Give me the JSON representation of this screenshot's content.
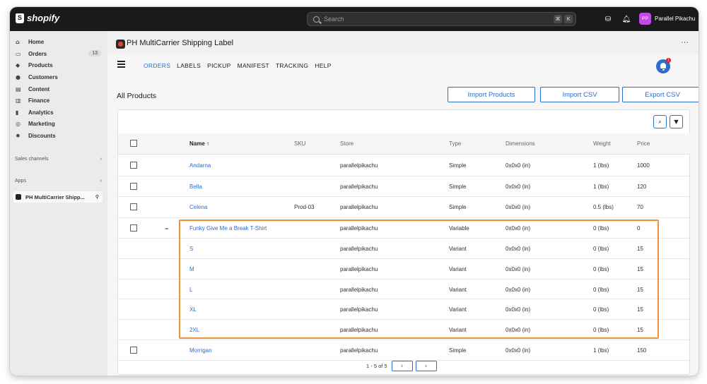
{
  "topbar": {
    "brand": "shopify",
    "search_placeholder": "Search",
    "shortcut_keys": [
      "⌘",
      "K"
    ],
    "user_initials": "PP",
    "user_name": "Parallel Pikachu"
  },
  "sidebar": {
    "items": [
      {
        "label": "Home",
        "icon": "home-icon",
        "glyph": "⌂"
      },
      {
        "label": "Orders",
        "icon": "orders-icon",
        "glyph": "▭",
        "badge": "13"
      },
      {
        "label": "Products",
        "icon": "tag-icon",
        "glyph": "◆"
      },
      {
        "label": "Customers",
        "icon": "person-icon",
        "glyph": "●"
      },
      {
        "label": "Content",
        "icon": "content-icon",
        "glyph": "▤"
      },
      {
        "label": "Finance",
        "icon": "bank-icon",
        "glyph": "▥"
      },
      {
        "label": "Analytics",
        "icon": "chart-icon",
        "glyph": "▮"
      },
      {
        "label": "Marketing",
        "icon": "target-icon",
        "glyph": "◎"
      },
      {
        "label": "Discounts",
        "icon": "discount-icon",
        "glyph": "✹"
      }
    ],
    "sales_channels_label": "Sales channels",
    "apps_label": "Apps",
    "app_item_label": "PH MultiCarrier Shipp..."
  },
  "app": {
    "title": "PH MultiCarrier Shipping Label",
    "more": "···",
    "tabs": [
      "ORDERS",
      "LABELS",
      "PICKUP",
      "MANIFEST",
      "TRACKING",
      "HELP"
    ],
    "active_tab": "ORDERS",
    "notification_count": "1"
  },
  "page": {
    "title": "All Products",
    "buttons": {
      "import_products": "Import Products",
      "import_csv": "Import CSV",
      "export_csv": "Export CSV"
    }
  },
  "table": {
    "columns": {
      "name": "Name ↑",
      "sku": "SKU",
      "store": "Store",
      "type": "Type",
      "dimensions": "Dimensions",
      "weight": "Weight",
      "price": "Price"
    },
    "rows": [
      {
        "name": "Andarna",
        "sku": "",
        "store": "parallelpikachu",
        "type": "Simple",
        "dimensions": "0x0x0 (in)",
        "weight": "1 (lbs)",
        "price": "1000"
      },
      {
        "name": "Bella",
        "sku": "",
        "store": "parallelpikachu",
        "type": "Simple",
        "dimensions": "0x0x0 (in)",
        "weight": "1 (lbs)",
        "price": "120"
      },
      {
        "name": "Celena",
        "sku": "Prod-03",
        "store": "parallelpikachu",
        "type": "Simple",
        "dimensions": "0x0x0 (in)",
        "weight": "0.5 (lbs)",
        "price": "70"
      },
      {
        "name": "Funky Give Me a Break T-Shirt",
        "sku": "",
        "store": "parallelpikachu",
        "type": "Variable",
        "dimensions": "0x0x0 (in)",
        "weight": "0 (lbs)",
        "price": "0"
      },
      {
        "name": "S",
        "sku": "",
        "store": "parallelpikachu",
        "type": "Variant",
        "dimensions": "0x0x0 (in)",
        "weight": "0 (lbs)",
        "price": "15"
      },
      {
        "name": "M",
        "sku": "",
        "store": "parallelpikachu",
        "type": "Variant",
        "dimensions": "0x0x0 (in)",
        "weight": "0 (lbs)",
        "price": "15"
      },
      {
        "name": "L",
        "sku": "",
        "store": "parallelpikachu",
        "type": "Variant",
        "dimensions": "0x0x0 (in)",
        "weight": "0 (lbs)",
        "price": "15"
      },
      {
        "name": "XL",
        "sku": "",
        "store": "parallelpikachu",
        "type": "Variant",
        "dimensions": "0x0x0 (in)",
        "weight": "0 (lbs)",
        "price": "15"
      },
      {
        "name": "2XL",
        "sku": "",
        "store": "parallelpikachu",
        "type": "Variant",
        "dimensions": "0x0x0 (in)",
        "weight": "0 (lbs)",
        "price": "15"
      },
      {
        "name": "Morrigan",
        "sku": "",
        "store": "parallelpikachu",
        "type": "Simple",
        "dimensions": "0x0x0 (in)",
        "weight": "1 (lbs)",
        "price": "150"
      }
    ],
    "collapse_symbol": "−",
    "pagination": "1 - 5 of 5",
    "prev": "‹",
    "next": "›"
  },
  "colors": {
    "accent": "#2c6ecb",
    "highlight": "#f0913a",
    "topbar": "#1a1a1a"
  }
}
